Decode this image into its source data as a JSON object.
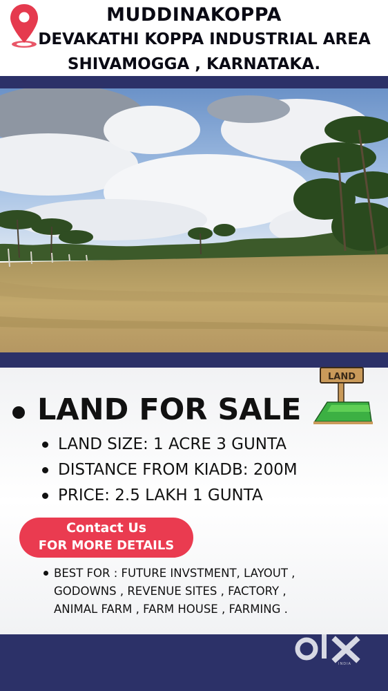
{
  "header": {
    "line1": "MUDDINAKOPPA",
    "line2": "DEVAKATHI KOPPA INDUSTRIAL AREA",
    "line3": "SHIVAMOGGA , KARNATAKA."
  },
  "listing": {
    "heading": "LAND FOR SALE",
    "sign_text": "LAND",
    "specs": [
      "LAND SIZE: 1 ACRE 3 GUNTA",
      "DISTANCE FROM KIADB: 200M",
      "PRICE: 2.5 LAKH 1 GUNTA"
    ]
  },
  "contact": {
    "line1": "Contact Us",
    "line2": "FOR MORE DETAILS"
  },
  "best_for": {
    "lines": [
      "BEST FOR : FUTURE INVSTMENT, LAYOUT ,",
      "GODOWNS , REVENUE SITES , FACTORY ,",
      "ANIMAL FARM , FARM HOUSE , FARMING ."
    ]
  },
  "brand": {
    "logo": "olx",
    "logo_sub": "INDIA"
  },
  "colors": {
    "navy_band": "#2c3168",
    "contact_button": "#ea3b50",
    "pin_marker": "#e53a4e",
    "sign_green": "#3cb043"
  },
  "icons": {
    "location": "location-pin-icon",
    "land_sign": "land-sign-icon"
  }
}
